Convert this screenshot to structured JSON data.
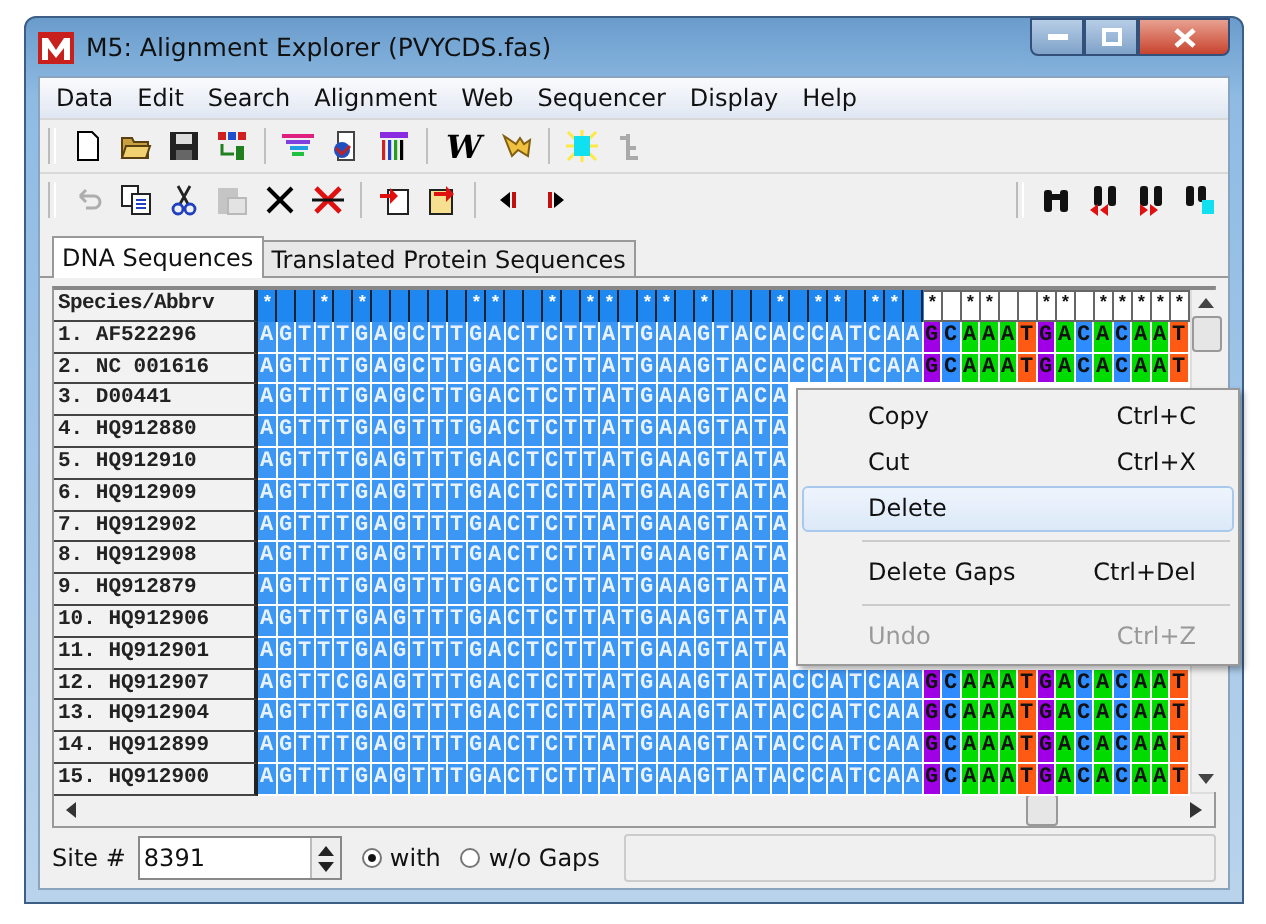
{
  "window": {
    "title": "M5: Alignment Explorer (PVYCDS.fas)"
  },
  "menu": [
    "Data",
    "Edit",
    "Search",
    "Alignment",
    "Web",
    "Sequencer",
    "Display",
    "Help"
  ],
  "toolbar": {
    "clustal_label": "W",
    "undo": {
      "disabled": true
    },
    "paste": {
      "disabled": true
    }
  },
  "tabs": [
    {
      "label": "DNA Sequences",
      "selected": true
    },
    {
      "label": "Translated Protein Sequences",
      "selected": false
    }
  ],
  "alignment": {
    "name_header": "Species/Abbrv",
    "conserved_marks": {
      "selected_bases": "*  * *     **  * ** ** *   * ** ** ",
      "other_bases": "* **  ** *****"
    },
    "rows": [
      {
        "name": "1. AF522296",
        "selected_bases": "AGTTTGAGCTTGACTCTTATGAAGTACACCATCAA",
        "other_bases": "GCAAATGACACAAT"
      },
      {
        "name": "2. NC 001616",
        "selected_bases": "AGTTTGAGCTTGACTCTTATGAAGTACACCATCAA",
        "other_bases": "GCAAATGACACAAT"
      },
      {
        "name": "3. D00441",
        "selected_bases": "AGTTTGAGCTTGACTCTTATGAAGTACA"
      },
      {
        "name": "4. HQ912880",
        "selected_bases": "AGTTTGAGTTTGACTCTTATGAAGTATA"
      },
      {
        "name": "5. HQ912910",
        "selected_bases": "AGTTTGAGTTTGACTCTTATGAAGTATA"
      },
      {
        "name": "6. HQ912909",
        "selected_bases": "AGTTTGAGTTTGACTCTTATGAAGTATA"
      },
      {
        "name": "7. HQ912902",
        "selected_bases": "AGTTTGAGTTTGACTCTTATGAAGTATA"
      },
      {
        "name": "8. HQ912908",
        "selected_bases": "AGTTTGAGTTTGACTCTTATGAAGTATA"
      },
      {
        "name": "9. HQ912879",
        "selected_bases": "AGTTTGAGTTTGACTCTTATGAAGTATA"
      },
      {
        "name": "10. HQ912906",
        "selected_bases": "AGTTTGAGTTTGACTCTTATGAAGTATA"
      },
      {
        "name": "11. HQ912901",
        "selected_bases": "AGTTTGAGTTTGACTCTTATGAAGTATA"
      },
      {
        "name": "12. HQ912907",
        "selected_bases": "AGTTCGAGTTTGACTCTTATGAAGTATACCATCAA",
        "other_bases": "GCAAATGACACAAT"
      },
      {
        "name": "13. HQ912904",
        "selected_bases": "AGTTTGAGTTTGACTCTTATGAAGTATACCATCAA",
        "other_bases": "GCAAATGACACAAT"
      },
      {
        "name": "14. HQ912899",
        "selected_bases": "AGTTTGAGTTTGACTCTTATGAAGTATACCATCAA",
        "other_bases": "GCAAATGACACAAT"
      },
      {
        "name": "15. HQ912900",
        "selected_bases": "AGTTTGAGTTTGACTCTTATGAAGTATACCATCAA",
        "other_bases": "GCAAATGACACAAT"
      }
    ]
  },
  "context_menu": [
    {
      "kind": "item",
      "label": "Copy",
      "shortcut": "Ctrl+C",
      "selected": false,
      "disabled": false
    },
    {
      "kind": "item",
      "label": "Cut",
      "shortcut": "Ctrl+X",
      "selected": false,
      "disabled": false
    },
    {
      "kind": "item",
      "label": "Delete",
      "selected": true,
      "disabled": false
    },
    {
      "kind": "separator"
    },
    {
      "kind": "item",
      "label": "Delete Gaps",
      "shortcut": "Ctrl+Del",
      "selected": false,
      "disabled": false
    },
    {
      "kind": "separator"
    },
    {
      "kind": "item",
      "label": "Undo",
      "shortcut": "Ctrl+Z",
      "selected": false,
      "disabled": true
    }
  ],
  "status": {
    "site_label": "Site #",
    "site_value": "8391",
    "gap_options": [
      {
        "label": "with",
        "selected": true
      },
      {
        "label": "w/o Gaps",
        "selected": false
      }
    ]
  }
}
